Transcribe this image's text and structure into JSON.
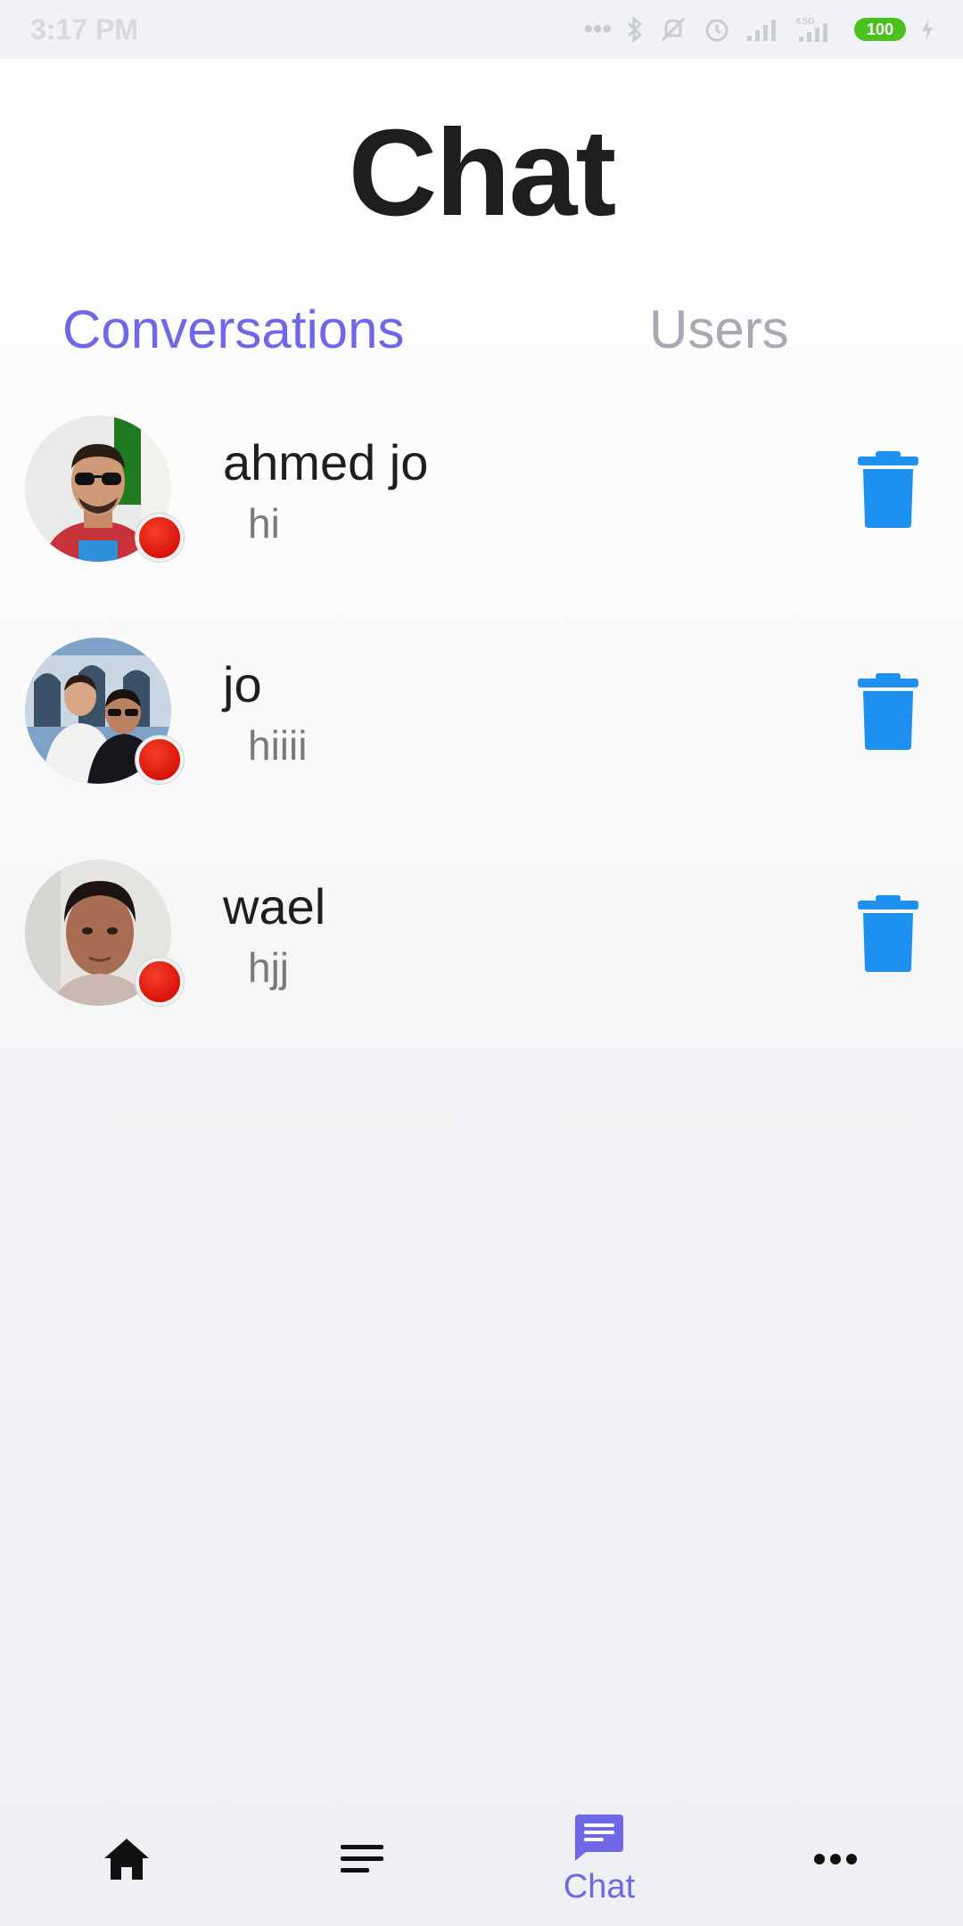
{
  "status_bar": {
    "time": "3:17 PM",
    "battery_level": "100",
    "network_label": "4.5G"
  },
  "title": "Chat",
  "tabs": [
    {
      "label": "Conversations",
      "active": true
    },
    {
      "label": "Users",
      "active": false
    }
  ],
  "conversations": [
    {
      "name": "ahmed jo",
      "last_message": "hi",
      "status": "offline"
    },
    {
      "name": "jo",
      "last_message": "hiiii",
      "status": "offline"
    },
    {
      "name": "wael",
      "last_message": "hjj",
      "status": "offline"
    }
  ],
  "bottom_nav": {
    "items": [
      {
        "icon": "home-icon",
        "label": ""
      },
      {
        "icon": "menu-lines-icon",
        "label": ""
      },
      {
        "icon": "chat-icon",
        "label": "Chat",
        "active": true
      },
      {
        "icon": "more-dots-icon",
        "label": ""
      }
    ]
  },
  "colors": {
    "accent": "#6f67e8",
    "inactive_tab": "#a7aab3",
    "delete": "#1e90f0",
    "status_offline": "#e0200f",
    "battery": "#4bc11e"
  }
}
